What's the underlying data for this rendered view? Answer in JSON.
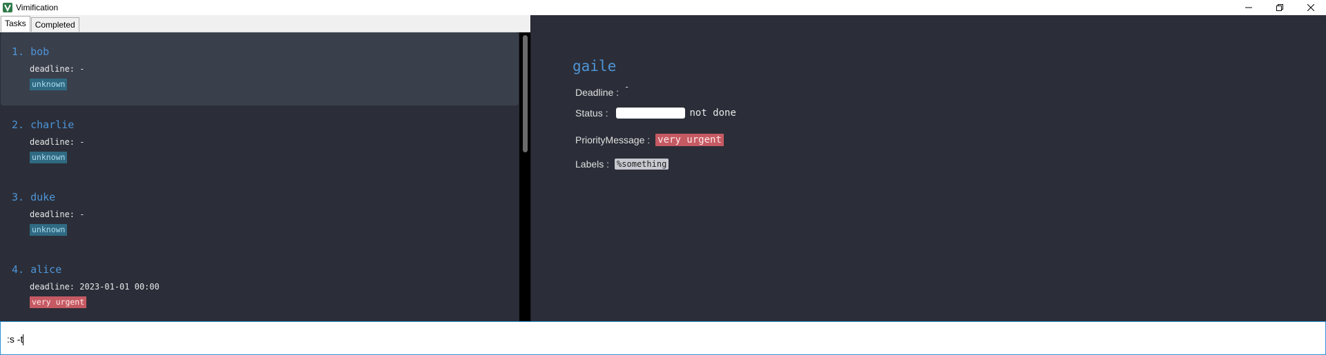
{
  "window": {
    "title": "Vimification",
    "icon": "app-logo-icon",
    "controls": [
      "minimize-icon",
      "restore-icon",
      "close-icon"
    ]
  },
  "tabs": [
    {
      "label": "Tasks",
      "active": true
    },
    {
      "label": "Completed",
      "active": false
    }
  ],
  "tasks": [
    {
      "index": "1.",
      "title": "bob",
      "deadline": "deadline: -",
      "priority": "unknown",
      "selected": true
    },
    {
      "index": "2.",
      "title": "charlie",
      "deadline": "deadline: -",
      "priority": "unknown",
      "selected": false
    },
    {
      "index": "3.",
      "title": "duke",
      "deadline": "deadline: -",
      "priority": "unknown",
      "selected": false
    },
    {
      "index": "4.",
      "title": "alice",
      "deadline": "deadline: 2023-01-01 00:00",
      "priority": "very urgent",
      "selected": false
    }
  ],
  "detail": {
    "name": "gaile",
    "deadline_label": "Deadline :",
    "deadline_value": "-",
    "status_label": "Status :",
    "status_value": "not done",
    "priority_label": "PriorityMessage :",
    "priority_value": "very urgent",
    "labels_label": "Labels :",
    "labels": [
      "%something"
    ]
  },
  "command": {
    "value": ":s -t"
  },
  "colors": {
    "background": "#2b2e38",
    "accent": "#4e95d9",
    "unknown_badge": "#2f6a82",
    "urgent_badge": "#c55a63",
    "command_border": "#2a8fd6"
  }
}
